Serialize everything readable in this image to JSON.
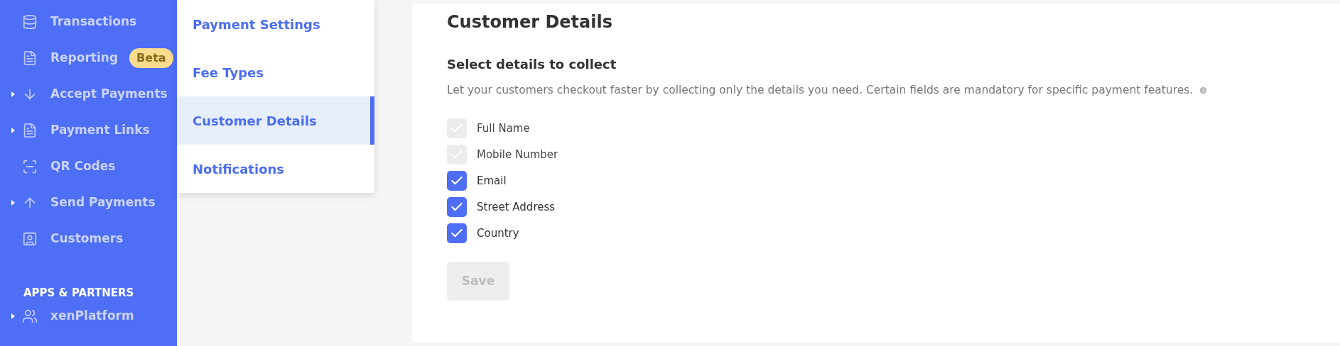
{
  "sidebar": {
    "items": [
      {
        "label": "Transactions",
        "expandable": false
      },
      {
        "label": "Reporting",
        "expandable": false,
        "badge": "Beta"
      },
      {
        "label": "Accept Payments",
        "expandable": true
      },
      {
        "label": "Payment Links",
        "expandable": true
      },
      {
        "label": "QR Codes",
        "expandable": false
      },
      {
        "label": "Send Payments",
        "expandable": true
      },
      {
        "label": "Customers",
        "expandable": false
      }
    ],
    "section_title": "APPS & PARTNERS",
    "section_items": [
      {
        "label": "xenPlatform",
        "expandable": true
      }
    ]
  },
  "submenu": {
    "items": [
      {
        "label": "Payment Settings",
        "selected": false
      },
      {
        "label": "Fee Types",
        "selected": false
      },
      {
        "label": "Customer Details",
        "selected": true
      },
      {
        "label": "Notifications",
        "selected": false
      }
    ]
  },
  "main": {
    "title": "Customer Details",
    "subtitle": "Select details to collect",
    "description": "Let your customers checkout faster by collecting only the details you need. Certain fields are mandatory for specific payment features.",
    "fields": [
      {
        "label": "Full Name",
        "checked": true,
        "disabled": true
      },
      {
        "label": "Mobile Number",
        "checked": true,
        "disabled": true
      },
      {
        "label": "Email",
        "checked": true,
        "disabled": false
      },
      {
        "label": "Street Address",
        "checked": true,
        "disabled": false
      },
      {
        "label": "Country",
        "checked": true,
        "disabled": false
      }
    ],
    "save_button": {
      "label": "Save",
      "disabled": true
    }
  }
}
